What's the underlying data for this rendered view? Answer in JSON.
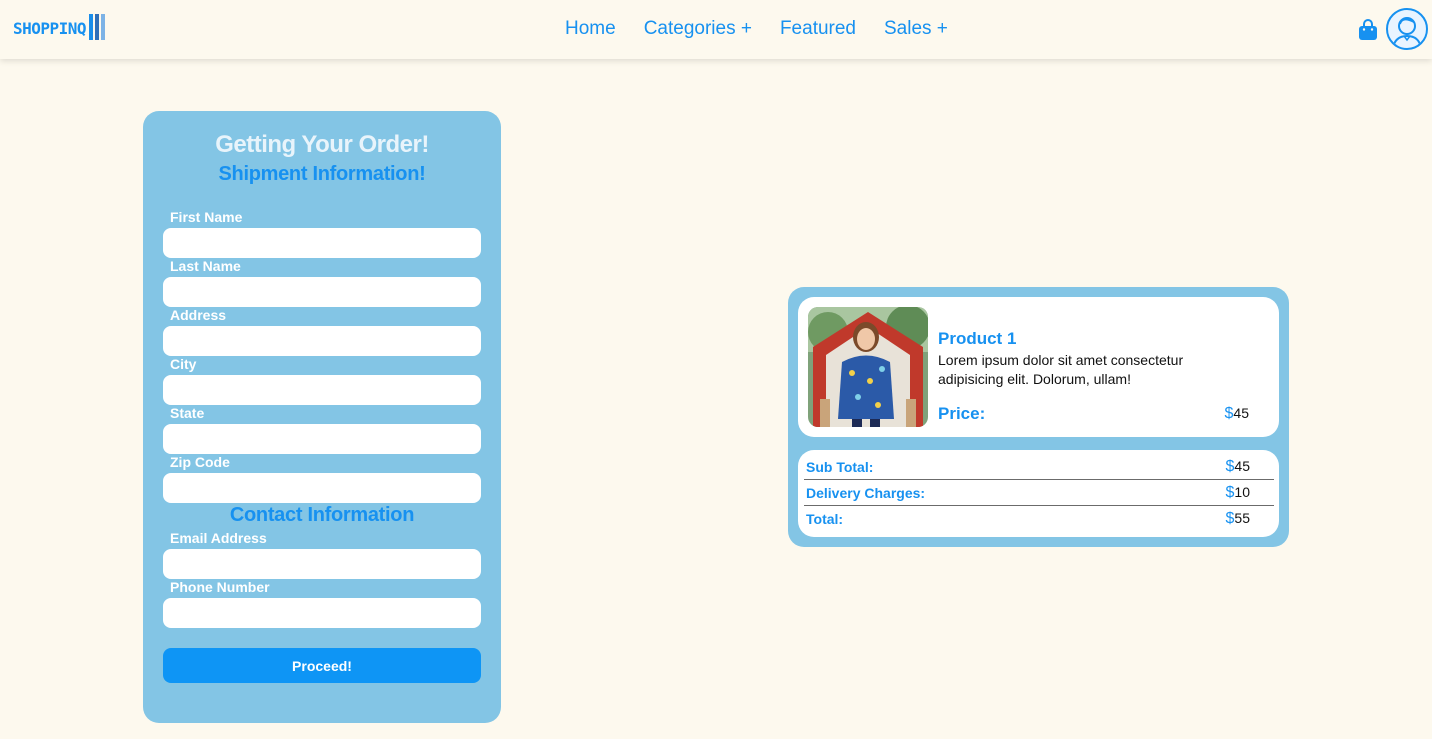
{
  "header": {
    "logo_text": "SHOPPINQ",
    "nav": [
      {
        "label": "Home"
      },
      {
        "label": "Categories +"
      },
      {
        "label": "Featured"
      },
      {
        "label": "Sales +"
      }
    ],
    "icons": {
      "cart": "shopping-bag-icon",
      "account": "user-avatar-icon"
    }
  },
  "order_form": {
    "title": "Getting Your Order!",
    "subtitle": "Shipment Information!",
    "shipment_fields": [
      {
        "label": "First Name",
        "value": "",
        "placeholder": ""
      },
      {
        "label": "Last Name",
        "value": "",
        "placeholder": ""
      },
      {
        "label": "Address",
        "value": "",
        "placeholder": ""
      },
      {
        "label": "City",
        "value": "",
        "placeholder": ""
      },
      {
        "label": "State",
        "value": "",
        "placeholder": ""
      },
      {
        "label": "Zip Code",
        "value": "",
        "placeholder": ""
      }
    ],
    "contact_heading": "Contact Information",
    "contact_fields": [
      {
        "label": "Email Address",
        "value": "",
        "placeholder": ""
      },
      {
        "label": "Phone Number",
        "value": "",
        "placeholder": ""
      }
    ],
    "submit_label": "Proceed!"
  },
  "summary": {
    "product": {
      "name": "Product 1",
      "description": "Lorem ipsum dolor sit amet consectetur adipisicing elit. Dolorum, ullam!",
      "price_label": "Price:",
      "currency": "$",
      "price": "45"
    },
    "totals": [
      {
        "label": "Sub Total:",
        "currency": "$",
        "value": "45"
      },
      {
        "label": "Delivery Charges:",
        "currency": "$",
        "value": "10"
      },
      {
        "label": "Total:",
        "currency": "$",
        "value": "55"
      }
    ]
  },
  "colors": {
    "accent": "#1791f0",
    "card": "#83c5e5",
    "page_bg": "#fdf9ee",
    "button": "#0e95f5"
  }
}
